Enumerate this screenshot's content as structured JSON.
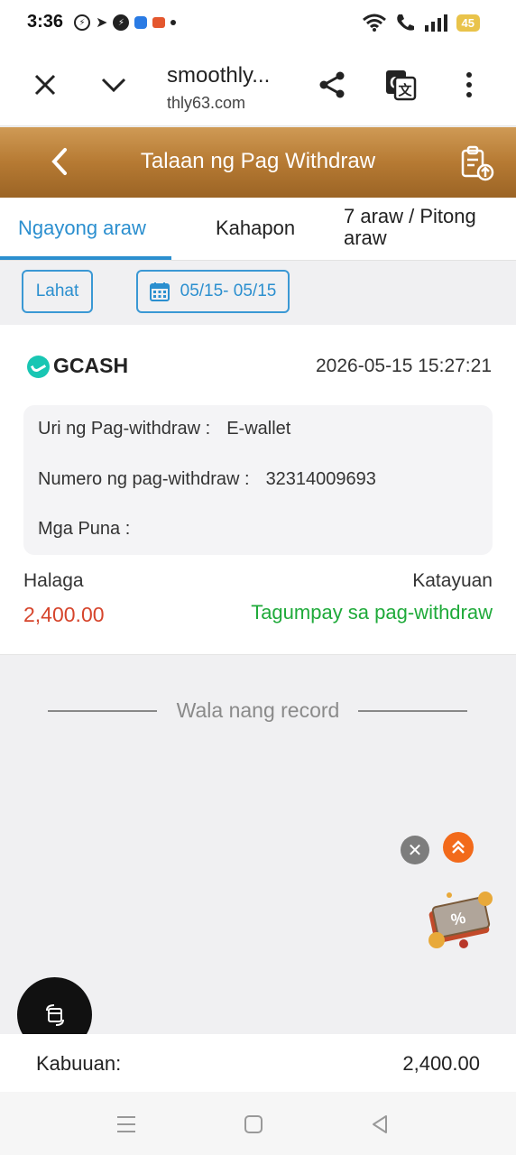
{
  "status": {
    "time": "3:36",
    "battery": "45",
    "app_icons": [
      "messenger-icon",
      "telegram-icon",
      "messenger-icon",
      "app-icon",
      "app-icon",
      "dot-icon"
    ]
  },
  "browser": {
    "title": "smoothly...",
    "url": "thly63.com",
    "icons": [
      "close-icon",
      "chevron-down-icon",
      "share-icon",
      "translate-icon",
      "more-icon"
    ]
  },
  "header": {
    "title": "Talaan ng Pag Withdraw"
  },
  "tabs": [
    {
      "label": "Ngayong araw",
      "active": true
    },
    {
      "label": "Kahapon",
      "active": false
    },
    {
      "label": "7 araw / Pitong araw",
      "active": false
    }
  ],
  "filters": {
    "all_label": "Lahat",
    "date_range": "05/15- 05/15"
  },
  "record": {
    "method": "GCASH",
    "datetime": "2026-05-15 15:27:21",
    "type_label": "Uri ng Pag-withdraw :",
    "type_value": "E-wallet",
    "number_label": "Numero ng pag-withdraw :",
    "number_value": "32314009693",
    "remarks_label": "Mga Puna :",
    "remarks_value": "",
    "amount_label": "Halaga",
    "amount_value": "2,400.00",
    "status_label": "Katayuan",
    "status_value": "Tagumpay sa pag-withdraw"
  },
  "no_record_text": "Wala nang record",
  "total": {
    "label": "Kabuuan:",
    "value": "2,400.00"
  },
  "colors": {
    "accent": "#2b8fcf",
    "header_gold": "#b67a33",
    "amount_red": "#d6452c",
    "success_green": "#1faa3a"
  }
}
